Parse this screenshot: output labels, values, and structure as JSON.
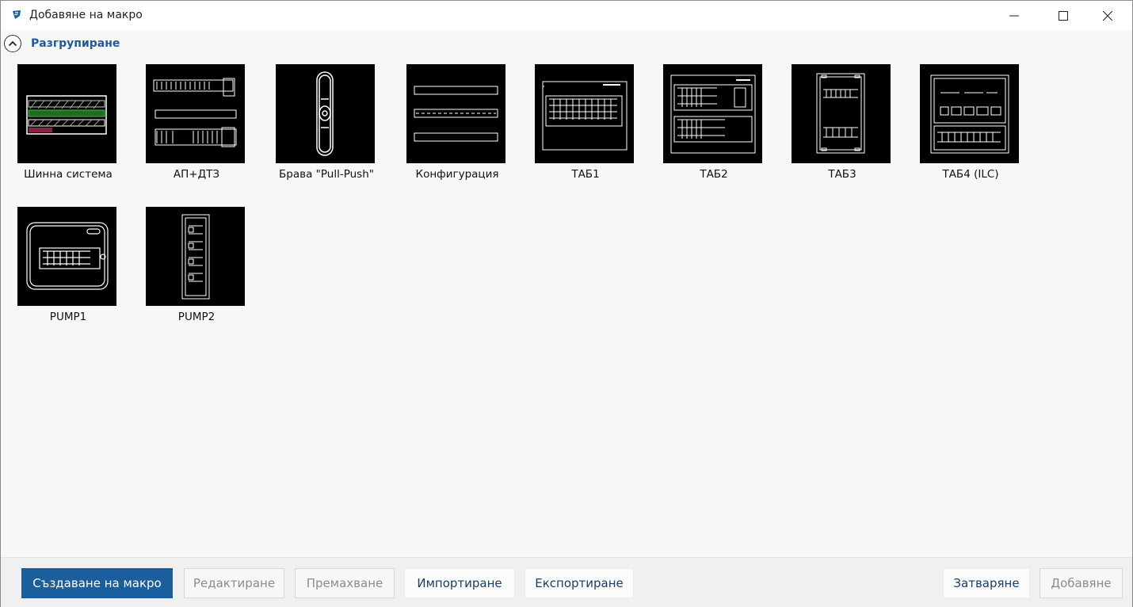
{
  "window": {
    "title": "Добавяне на макро"
  },
  "group": {
    "label": "Разгрупиране"
  },
  "macros": [
    {
      "label": "Шинна система",
      "thumbnail": "busbar-system-drawing"
    },
    {
      "label": "АП+ДТЗ",
      "thumbnail": "breaker-rcd-drawing"
    },
    {
      "label": "Брава \"Pull-Push\"",
      "thumbnail": "door-lock-drawing"
    },
    {
      "label": "Конфигурация",
      "thumbnail": "configuration-drawing"
    },
    {
      "label": "ТАБ1",
      "thumbnail": "panel-1-drawing"
    },
    {
      "label": "ТАБ2",
      "thumbnail": "panel-2-drawing"
    },
    {
      "label": "ТАБ3",
      "thumbnail": "panel-3-drawing"
    },
    {
      "label": "ТАБ4 (ILC)",
      "thumbnail": "panel-4-drawing"
    },
    {
      "label": "PUMP1",
      "thumbnail": "pump-1-drawing"
    },
    {
      "label": "PUMP2",
      "thumbnail": "pump-2-drawing"
    }
  ],
  "footer": {
    "create": "Създаване на макро",
    "edit": "Редактиране",
    "remove": "Премахване",
    "import": "Импортиране",
    "export": "Експортиране",
    "close": "Затваряне",
    "add": "Добавяне"
  },
  "colors": {
    "accent": "#1b5e9e",
    "link": "#1e5a9e",
    "thumbnail_bg": "#000000",
    "drawing": "#ffffff"
  }
}
